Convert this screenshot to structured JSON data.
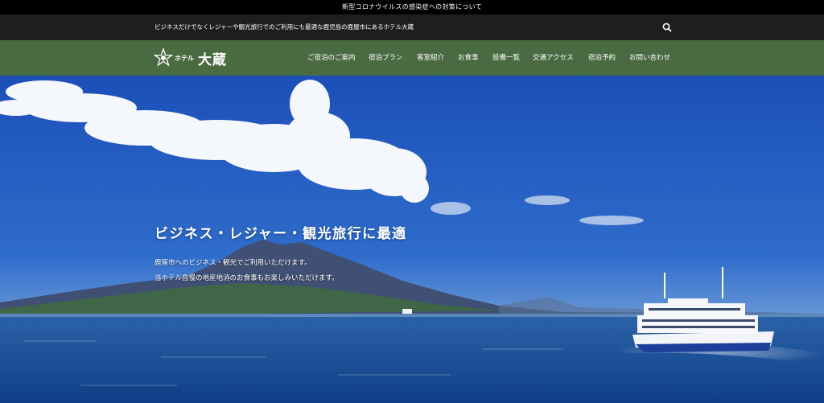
{
  "notice_bar": {
    "text": "新型コロナウイルスの感染症への対策について"
  },
  "top_bar": {
    "tagline": "ビジネスだけでなくレジャーや観光旅行でのご利用にも最適な鹿児島の鹿屋市にあるホテル大蔵",
    "search_icon": "search-icon"
  },
  "header": {
    "logo": {
      "small": "ホテル",
      "big": "大蔵"
    },
    "nav": [
      {
        "label": "ご宿泊のご案内"
      },
      {
        "label": "宿泊プラン"
      },
      {
        "label": "客室紹介"
      },
      {
        "label": "お食事"
      },
      {
        "label": "設備一覧"
      },
      {
        "label": "交通アクセス"
      },
      {
        "label": "宿泊予約"
      },
      {
        "label": "お問い合わせ"
      }
    ]
  },
  "hero": {
    "headline": "ビジネス・レジャー・観光旅行に最適",
    "lines": [
      "鹿屋市へのビジネス・観光でご利用いただけます。",
      "当ホテル自慢の地産地消のお食事もお楽しみいただけます。"
    ]
  },
  "colors": {
    "nav_green": "#4a6b42",
    "top_bar": "#1e1e1e",
    "notice": "#000000"
  }
}
